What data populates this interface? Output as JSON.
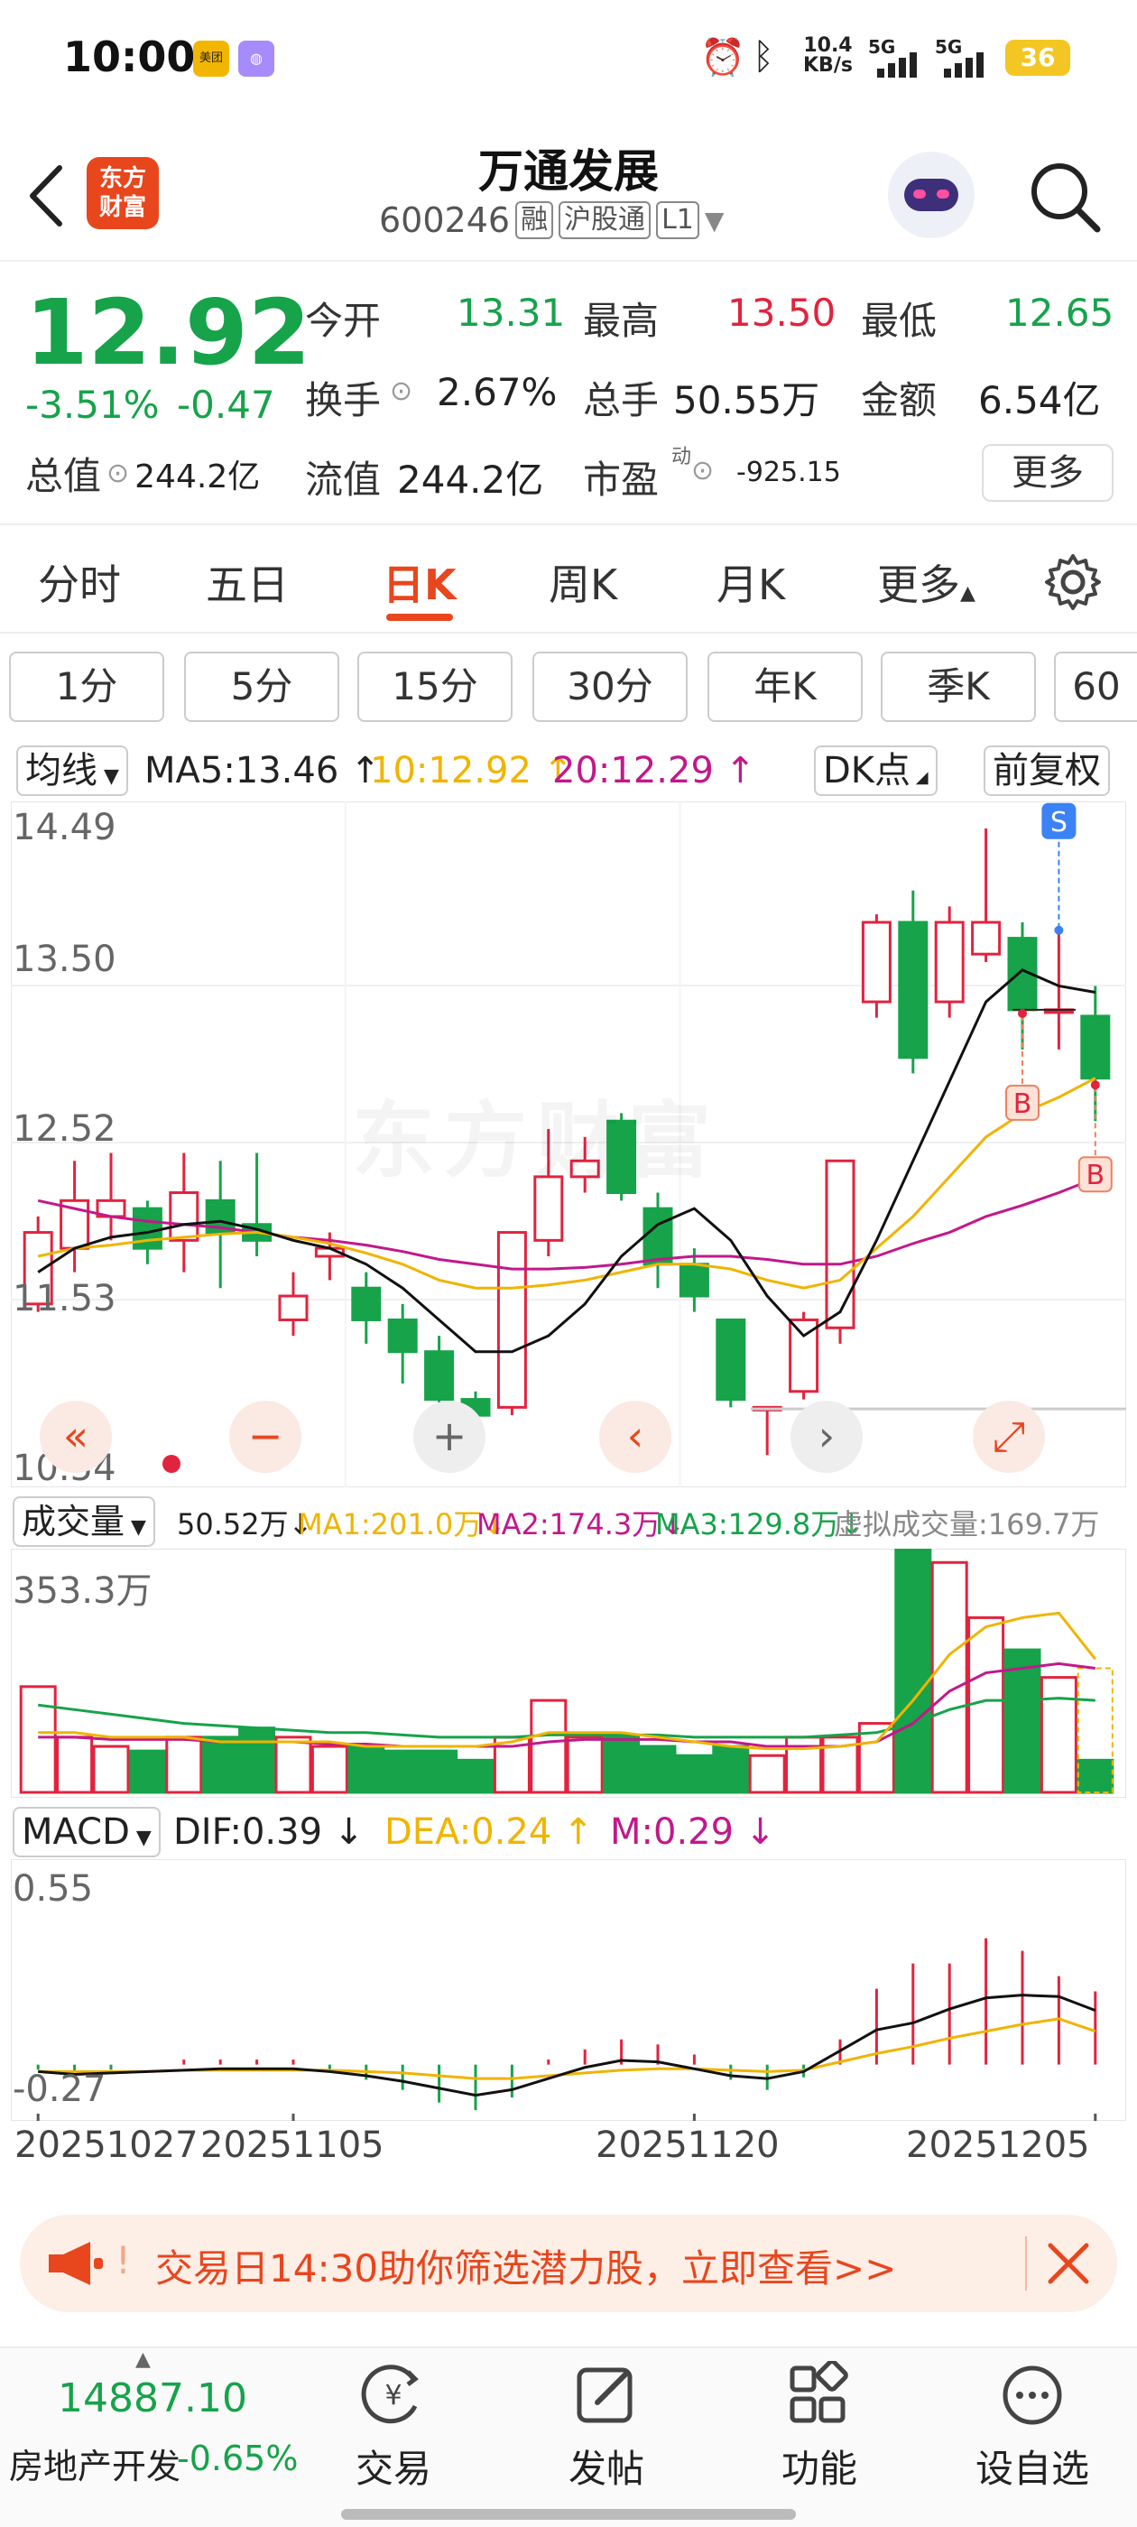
{
  "status_bar": {
    "time": "10:00",
    "net_speed_value": "10.4",
    "net_speed_unit": "KB/s",
    "sig1": "5G",
    "sig2": "5G",
    "battery": "36",
    "app_icon_1": "美团"
  },
  "header": {
    "logo_line1": "东方",
    "logo_line2": "财富",
    "stock_name": "万通发展",
    "stock_code": "600246",
    "tag_margin": "融",
    "tag_connect": "沪股通",
    "tag_level": "L1"
  },
  "quote": {
    "price": "12.92",
    "change_pct": "-3.51%",
    "change_abs": "-0.47",
    "open_label": "今开",
    "open": "13.31",
    "high_label": "最高",
    "high": "13.50",
    "low_label": "最低",
    "low": "12.65",
    "turnover_label": "换手",
    "turnover": "2.67%",
    "volume_label": "总手",
    "volume": "50.55万",
    "amount_label": "金额",
    "amount": "6.54亿",
    "mcap_label": "总值",
    "mcap": "244.2亿",
    "float_label": "流值",
    "float_cap": "244.2亿",
    "pe_label": "市盈",
    "pe_sup": "动",
    "pe": "-925.15",
    "more_label": "更多"
  },
  "tabs": [
    "分时",
    "五日",
    "日K",
    "周K",
    "月K",
    "更多"
  ],
  "active_tab": "日K",
  "periods": [
    "1分",
    "5分",
    "15分",
    "30分",
    "年K",
    "季K",
    "60"
  ],
  "ma_line": {
    "selector": "均线",
    "ma5": "MA5:13.46 ↑",
    "ma10": "10:12.92 ↑",
    "ma20": "20:12.29 ↑",
    "dk": "DK点",
    "adjust": "前复权"
  },
  "price_axis": [
    "14.49",
    "13.50",
    "12.52",
    "11.53",
    "10.54"
  ],
  "watermark": "东方财富",
  "vol_line": {
    "selector": "成交量",
    "vol": "50.52万↓",
    "ma1": "MA1:201.0万↓",
    "ma2": "MA2:174.3万↓",
    "ma3": "MA3:129.8万↓",
    "virtual": "虚拟成交量:169.7万",
    "axis_top": "353.3万"
  },
  "macd_line": {
    "selector": "MACD",
    "dif": "DIF:0.39 ↓",
    "dea": "DEA:0.24 ↑",
    "m": "M:0.29 ↓",
    "axis_top": "0.55",
    "axis_bottom": "-0.27"
  },
  "dates": [
    "20251027",
    "20251105",
    "20251120",
    "20251205"
  ],
  "colors": {
    "up": "#e2233e",
    "down": "#16a34a",
    "ma5": "#111111",
    "ma10": "#f0b400",
    "ma20": "#c2188b",
    "brand": "#e8461d"
  },
  "chart_data": {
    "type": "candlestick",
    "ylim": [
      10.54,
      14.49
    ],
    "candles": [
      {
        "o": 11.5,
        "c": 11.95,
        "h": 12.05,
        "l": 11.45
      },
      {
        "o": 11.85,
        "c": 12.15,
        "h": 12.4,
        "l": 11.7
      },
      {
        "o": 12.05,
        "c": 12.15,
        "h": 12.45,
        "l": 11.9
      },
      {
        "o": 12.1,
        "c": 11.85,
        "h": 12.15,
        "l": 11.75
      },
      {
        "o": 11.9,
        "c": 12.2,
        "h": 12.45,
        "l": 11.7
      },
      {
        "o": 12.15,
        "c": 11.95,
        "h": 12.4,
        "l": 11.6
      },
      {
        "o": 12.0,
        "c": 11.9,
        "h": 12.45,
        "l": 11.8
      },
      {
        "o": 11.4,
        "c": 11.55,
        "h": 11.7,
        "l": 11.3
      },
      {
        "o": 11.8,
        "c": 11.85,
        "h": 11.95,
        "l": 11.65
      },
      {
        "o": 11.6,
        "c": 11.4,
        "h": 11.7,
        "l": 11.25
      },
      {
        "o": 11.4,
        "c": 11.2,
        "h": 11.5,
        "l": 11.0
      },
      {
        "o": 11.2,
        "c": 10.9,
        "h": 11.3,
        "l": 10.85
      },
      {
        "o": 10.9,
        "c": 10.8,
        "h": 10.95,
        "l": 10.7
      },
      {
        "o": 10.85,
        "c": 11.95,
        "h": 11.95,
        "l": 10.8
      },
      {
        "o": 11.9,
        "c": 12.3,
        "h": 12.6,
        "l": 11.8
      },
      {
        "o": 12.3,
        "c": 12.4,
        "h": 12.55,
        "l": 12.2
      },
      {
        "o": 12.65,
        "c": 12.2,
        "h": 12.7,
        "l": 12.15
      },
      {
        "o": 12.1,
        "c": 11.75,
        "h": 12.2,
        "l": 11.6
      },
      {
        "o": 11.75,
        "c": 11.55,
        "h": 11.85,
        "l": 11.45
      },
      {
        "o": 11.4,
        "c": 10.9,
        "h": 11.4,
        "l": 10.85
      },
      {
        "o": 10.85,
        "c": 10.85,
        "h": 10.85,
        "l": 10.55
      },
      {
        "o": 10.95,
        "c": 11.4,
        "h": 11.45,
        "l": 10.9
      },
      {
        "o": 11.35,
        "c": 12.4,
        "h": 12.4,
        "l": 11.25
      },
      {
        "o": 13.4,
        "c": 13.9,
        "h": 13.95,
        "l": 13.3
      },
      {
        "o": 13.9,
        "c": 13.05,
        "h": 14.1,
        "l": 12.95
      },
      {
        "o": 13.4,
        "c": 13.9,
        "h": 14.0,
        "l": 13.3
      },
      {
        "o": 13.7,
        "c": 13.9,
        "h": 14.49,
        "l": 13.65
      },
      {
        "o": 13.8,
        "c": 13.35,
        "h": 13.9,
        "l": 13.1
      },
      {
        "o": 13.35,
        "c": 13.35,
        "h": 13.85,
        "l": 13.1
      },
      {
        "o": 13.31,
        "c": 12.92,
        "h": 13.5,
        "l": 12.65
      }
    ],
    "ma5": [
      11.7,
      11.85,
      11.92,
      11.95,
      12.0,
      12.02,
      11.97,
      11.9,
      11.85,
      11.75,
      11.6,
      11.4,
      11.2,
      11.2,
      11.3,
      11.5,
      11.8,
      12.0,
      12.1,
      11.9,
      11.55,
      11.3,
      11.45,
      11.9,
      12.4,
      12.9,
      13.4,
      13.6,
      13.5,
      13.46
    ],
    "ma10": [
      11.8,
      11.85,
      11.87,
      11.9,
      11.92,
      11.94,
      11.95,
      11.92,
      11.88,
      11.82,
      11.75,
      11.65,
      11.6,
      11.6,
      11.62,
      11.65,
      11.7,
      11.75,
      11.75,
      11.72,
      11.65,
      11.6,
      11.65,
      11.85,
      12.05,
      12.3,
      12.55,
      12.7,
      12.8,
      12.92
    ],
    "ma20": [
      12.15,
      12.1,
      12.05,
      12.02,
      12.0,
      11.98,
      11.95,
      11.92,
      11.9,
      11.87,
      11.83,
      11.78,
      11.75,
      11.72,
      11.72,
      11.73,
      11.75,
      11.78,
      11.8,
      11.8,
      11.78,
      11.75,
      11.75,
      11.8,
      11.88,
      11.95,
      12.05,
      12.12,
      12.2,
      12.29
    ],
    "signals": [
      {
        "label": "S",
        "index": 28
      },
      {
        "label": "B",
        "index": 27
      },
      {
        "label": "B",
        "index": 29
      }
    ],
    "volume": [
      2.3,
      1.2,
      1.0,
      0.9,
      1.2,
      1.2,
      1.4,
      1.2,
      1.0,
      1.0,
      0.9,
      0.9,
      0.7,
      1.2,
      2.0,
      1.2,
      1.2,
      1.0,
      0.8,
      1.0,
      0.8,
      1.2,
      1.2,
      1.5,
      5.3,
      5.0,
      3.8,
      3.1,
      2.5,
      0.7
    ],
    "vol_ma1": [
      1.3,
      1.3,
      1.2,
      1.2,
      1.2,
      1.1,
      1.1,
      1.1,
      1.1,
      1.0,
      1.0,
      1.0,
      1.0,
      1.1,
      1.3,
      1.3,
      1.3,
      1.2,
      1.1,
      1.0,
      0.95,
      0.95,
      1.0,
      1.1,
      2.0,
      3.0,
      3.6,
      3.8,
      3.9,
      2.9
    ],
    "vol_ma2": [
      1.2,
      1.2,
      1.15,
      1.15,
      1.15,
      1.1,
      1.1,
      1.1,
      1.05,
      1.05,
      1.0,
      1.0,
      1.0,
      1.0,
      1.1,
      1.15,
      1.15,
      1.15,
      1.1,
      1.1,
      1.0,
      1.0,
      1.0,
      1.1,
      1.5,
      2.2,
      2.6,
      2.7,
      2.8,
      2.7
    ],
    "vol_ma3": [
      1.9,
      1.8,
      1.7,
      1.6,
      1.5,
      1.45,
      1.4,
      1.35,
      1.3,
      1.3,
      1.25,
      1.2,
      1.2,
      1.2,
      1.25,
      1.25,
      1.25,
      1.25,
      1.2,
      1.2,
      1.2,
      1.2,
      1.25,
      1.3,
      1.5,
      1.8,
      2.0,
      2.0,
      2.05,
      2.0
    ],
    "macd_ylim": [
      -0.27,
      0.55
    ],
    "dif": [
      -0.05,
      -0.07,
      -0.06,
      -0.05,
      -0.04,
      -0.03,
      -0.03,
      -0.03,
      -0.05,
      -0.08,
      -0.12,
      -0.17,
      -0.22,
      -0.18,
      -0.1,
      -0.02,
      0.03,
      0.02,
      -0.03,
      -0.08,
      -0.1,
      -0.05,
      0.1,
      0.25,
      0.3,
      0.4,
      0.48,
      0.5,
      0.49,
      0.39
    ],
    "dea": [
      -0.05,
      -0.05,
      -0.05,
      -0.05,
      -0.04,
      -0.04,
      -0.04,
      -0.04,
      -0.04,
      -0.05,
      -0.06,
      -0.08,
      -0.1,
      -0.1,
      -0.08,
      -0.06,
      -0.04,
      -0.03,
      -0.03,
      -0.04,
      -0.05,
      -0.04,
      0.02,
      0.08,
      0.13,
      0.19,
      0.24,
      0.29,
      0.33,
      0.24
    ],
    "macd": [
      -0.02,
      -0.03,
      -0.02,
      0.0,
      0.02,
      0.02,
      0.02,
      0.02,
      -0.02,
      -0.06,
      -0.1,
      -0.15,
      -0.18,
      -0.13,
      0.02,
      0.06,
      0.1,
      0.08,
      0.04,
      -0.06,
      -0.1,
      -0.05,
      0.1,
      0.3,
      0.4,
      0.4,
      0.5,
      0.45,
      0.35,
      0.29
    ],
    "date_indices": [
      0,
      7,
      18,
      29
    ]
  },
  "banner": {
    "text": "交易日14:30助你筛选潜力股，立即查看>>"
  },
  "bottom": {
    "index_value": "14887.10",
    "index_name": "房地产开发",
    "index_change": "-0.65%",
    "items": [
      "交易",
      "发帖",
      "功能",
      "设自选"
    ]
  }
}
